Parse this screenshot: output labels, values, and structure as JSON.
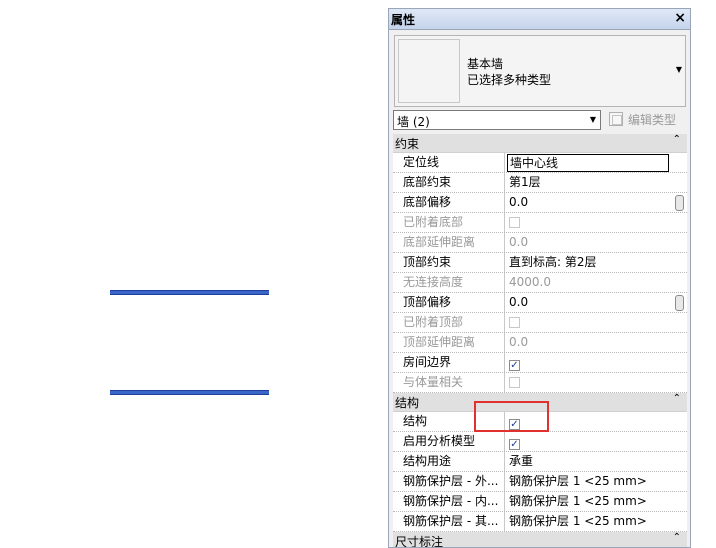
{
  "colors": {
    "wall": "#3a64c8",
    "highlight": "#e03030",
    "panel_bg": "#f0f0f0"
  },
  "panel": {
    "title": "属性",
    "close_icon": "close-icon",
    "type": {
      "line1": "基本墙",
      "line2": "已选择多种类型"
    },
    "selector": {
      "value": "墙 (2)"
    },
    "edit_type": {
      "label": "编辑类型",
      "icon": "edit-type-icon"
    }
  },
  "groups": [
    {
      "label": "约束",
      "rows": [
        {
          "name": "定位线",
          "value": "墙中心线",
          "disabled": false,
          "boxed": true
        },
        {
          "name": "底部约束",
          "value": "第1层",
          "disabled": false
        },
        {
          "name": "底部偏移",
          "value": "0.0",
          "disabled": false
        },
        {
          "name": "已附着底部",
          "checkbox": true,
          "checked": false,
          "disabled": true
        },
        {
          "name": "底部延伸距离",
          "value": "0.0",
          "disabled": true
        },
        {
          "name": "顶部约束",
          "value": "直到标高: 第2层",
          "disabled": false
        },
        {
          "name": "无连接高度",
          "value": "4000.0",
          "disabled": true
        },
        {
          "name": "顶部偏移",
          "value": "0.0",
          "disabled": false
        },
        {
          "name": "已附着顶部",
          "checkbox": true,
          "checked": false,
          "disabled": true
        },
        {
          "name": "顶部延伸距离",
          "value": "0.0",
          "disabled": true
        },
        {
          "name": "房间边界",
          "checkbox": true,
          "checked": true,
          "disabled": false
        },
        {
          "name": "与体量相关",
          "checkbox": true,
          "checked": false,
          "disabled": true
        }
      ]
    },
    {
      "label": "结构",
      "rows": [
        {
          "name": "结构",
          "checkbox": true,
          "checked": true,
          "disabled": false
        },
        {
          "name": "启用分析模型",
          "checkbox": true,
          "checked": true,
          "disabled": false
        },
        {
          "name": "结构用途",
          "value": "承重",
          "disabled": false
        },
        {
          "name": "钢筋保护层 - 外...",
          "value": "钢筋保护层 1 <25 mm>",
          "disabled": false
        },
        {
          "name": "钢筋保护层 - 内...",
          "value": "钢筋保护层 1 <25 mm>",
          "disabled": false
        },
        {
          "name": "钢筋保护层 - 其...",
          "value": "钢筋保护层 1 <25 mm>",
          "disabled": false
        }
      ]
    },
    {
      "label": "尺寸标注",
      "rows": []
    }
  ]
}
